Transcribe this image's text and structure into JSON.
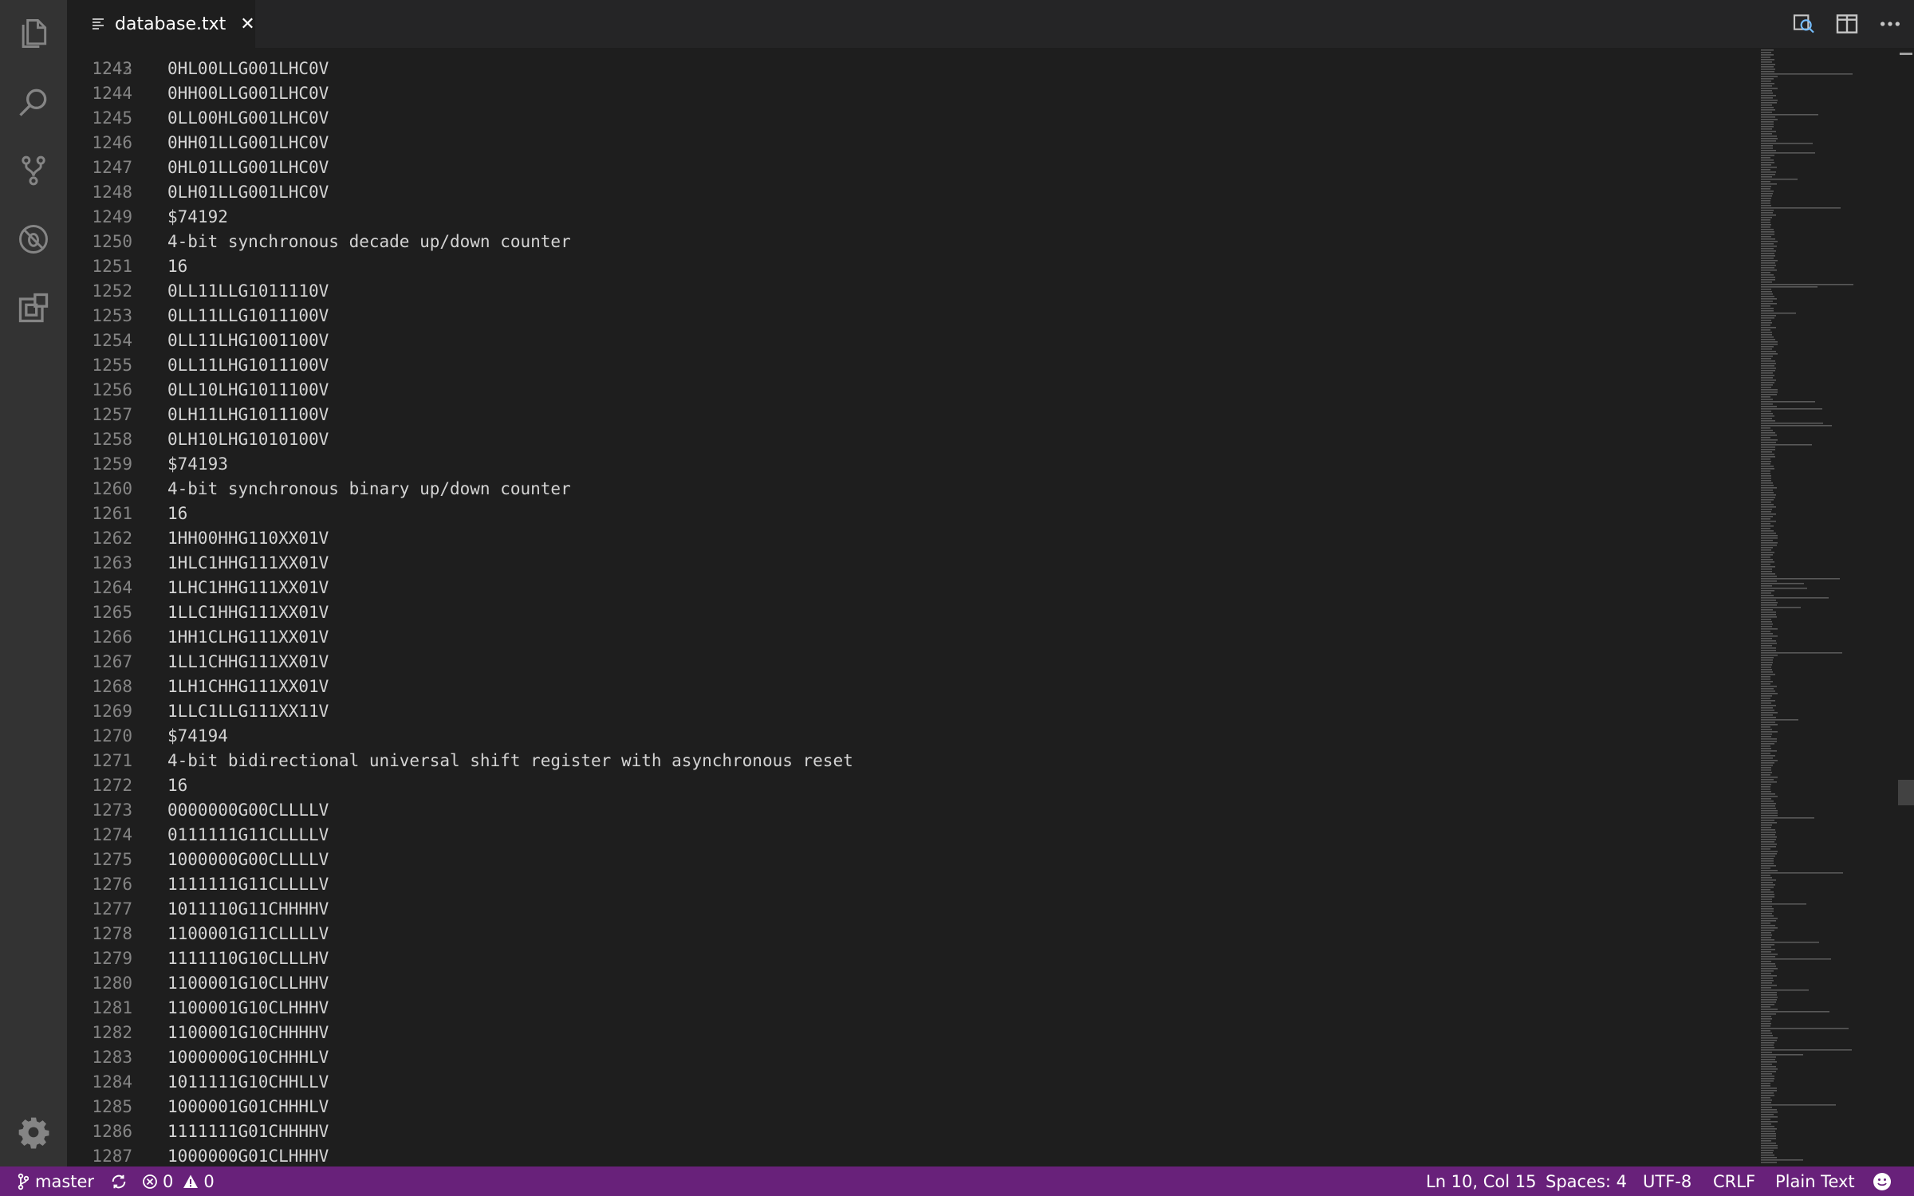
{
  "tab": {
    "title": "database.txt",
    "close_glyph": "✕"
  },
  "activity_icons": [
    "files-icon",
    "search-icon",
    "source-control-icon",
    "debug-icon",
    "extensions-icon",
    "gear-icon"
  ],
  "editor": {
    "lines": [
      {
        "n": "1243",
        "t": "0HL00LLG001LHC0V"
      },
      {
        "n": "1244",
        "t": "0HH00LLG001LHC0V"
      },
      {
        "n": "1245",
        "t": "0LL00HLG001LHC0V"
      },
      {
        "n": "1246",
        "t": "0HH01LLG001LHC0V"
      },
      {
        "n": "1247",
        "t": "0HL01LLG001LHC0V"
      },
      {
        "n": "1248",
        "t": "0LH01LLG001LHC0V"
      },
      {
        "n": "1249",
        "t": "$74192"
      },
      {
        "n": "1250",
        "t": "4-bit synchronous decade up/down counter"
      },
      {
        "n": "1251",
        "t": "16"
      },
      {
        "n": "1252",
        "t": "0LL11LLG1011110V"
      },
      {
        "n": "1253",
        "t": "0LL11LLG1011100V"
      },
      {
        "n": "1254",
        "t": "0LL11LHG1001100V"
      },
      {
        "n": "1255",
        "t": "0LL11LHG1011100V"
      },
      {
        "n": "1256",
        "t": "0LL10LHG1011100V"
      },
      {
        "n": "1257",
        "t": "0LH11LHG1011100V"
      },
      {
        "n": "1258",
        "t": "0LH10LHG1010100V"
      },
      {
        "n": "1259",
        "t": "$74193"
      },
      {
        "n": "1260",
        "t": "4-bit synchronous binary up/down counter"
      },
      {
        "n": "1261",
        "t": "16"
      },
      {
        "n": "1262",
        "t": "1HH00HHG110XX01V"
      },
      {
        "n": "1263",
        "t": "1HLC1HHG111XX01V"
      },
      {
        "n": "1264",
        "t": "1LHC1HHG111XX01V"
      },
      {
        "n": "1265",
        "t": "1LLC1HHG111XX01V"
      },
      {
        "n": "1266",
        "t": "1HH1CLHG111XX01V"
      },
      {
        "n": "1267",
        "t": "1LL1CHHG111XX01V"
      },
      {
        "n": "1268",
        "t": "1LH1CHHG111XX01V"
      },
      {
        "n": "1269",
        "t": "1LLC1LLG111XX11V"
      },
      {
        "n": "1270",
        "t": "$74194"
      },
      {
        "n": "1271",
        "t": "4-bit bidirectional universal shift register with asynchronous reset"
      },
      {
        "n": "1272",
        "t": "16"
      },
      {
        "n": "1273",
        "t": "0000000G00CLLLLV"
      },
      {
        "n": "1274",
        "t": "0111111G11CLLLLV"
      },
      {
        "n": "1275",
        "t": "1000000G00CLLLLV"
      },
      {
        "n": "1276",
        "t": "1111111G11CLLLLV"
      },
      {
        "n": "1277",
        "t": "1011110G11CHHHHV"
      },
      {
        "n": "1278",
        "t": "1100001G11CLLLLV"
      },
      {
        "n": "1279",
        "t": "1111110G10CLLLHV"
      },
      {
        "n": "1280",
        "t": "1100001G10CLLHHV"
      },
      {
        "n": "1281",
        "t": "1100001G10CLHHHV"
      },
      {
        "n": "1282",
        "t": "1100001G10CHHHHV"
      },
      {
        "n": "1283",
        "t": "1000000G10CHHHLV"
      },
      {
        "n": "1284",
        "t": "1011111G10CHHLLV"
      },
      {
        "n": "1285",
        "t": "1000001G01CHHHLV"
      },
      {
        "n": "1286",
        "t": "1111111G01CHHHHV"
      },
      {
        "n": "1287",
        "t": "1000000G01CLHHHV"
      }
    ]
  },
  "status": {
    "branch": "master",
    "errors": "0",
    "warnings": "0",
    "cursor": "Ln 10, Col 15",
    "indent": "Spaces: 4",
    "encoding": "UTF-8",
    "eol": "CRLF",
    "language": "Plain Text"
  },
  "colors": {
    "status_bar": "#68217a",
    "editor_bg": "#1e1e1e",
    "activity_bar": "#333333"
  }
}
